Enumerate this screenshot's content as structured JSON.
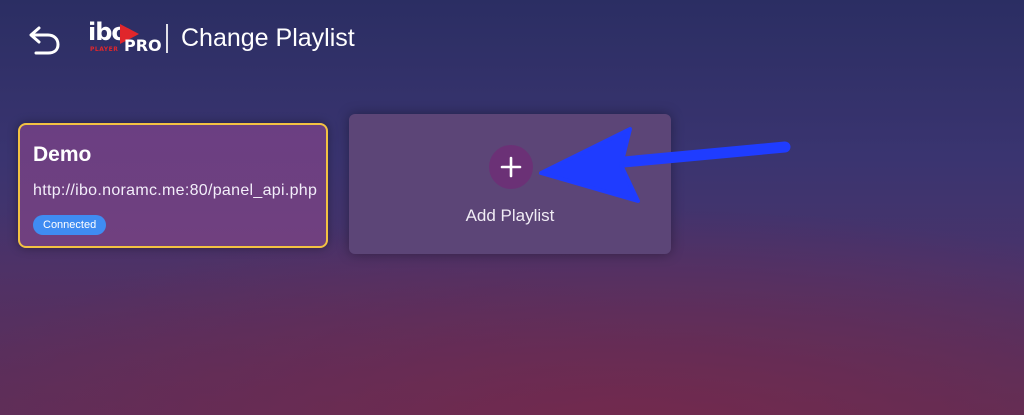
{
  "header": {
    "back_icon": "back-arrow-icon",
    "logo": {
      "main": "ibo",
      "sub": "PLAYER",
      "pro": "PRO",
      "play_color": "#e0262b"
    },
    "title": "Change Playlist"
  },
  "playlists": [
    {
      "name": "Demo",
      "url": "http://ibo.noramc.me:80/panel_api.php",
      "status": "Connected",
      "selected": true
    }
  ],
  "add_playlist": {
    "icon": "plus-icon",
    "label": "Add Playlist"
  },
  "colors": {
    "selected_border": "#f3c242",
    "badge": "#3f8cf2",
    "annotation_arrow": "#1f3cff"
  }
}
